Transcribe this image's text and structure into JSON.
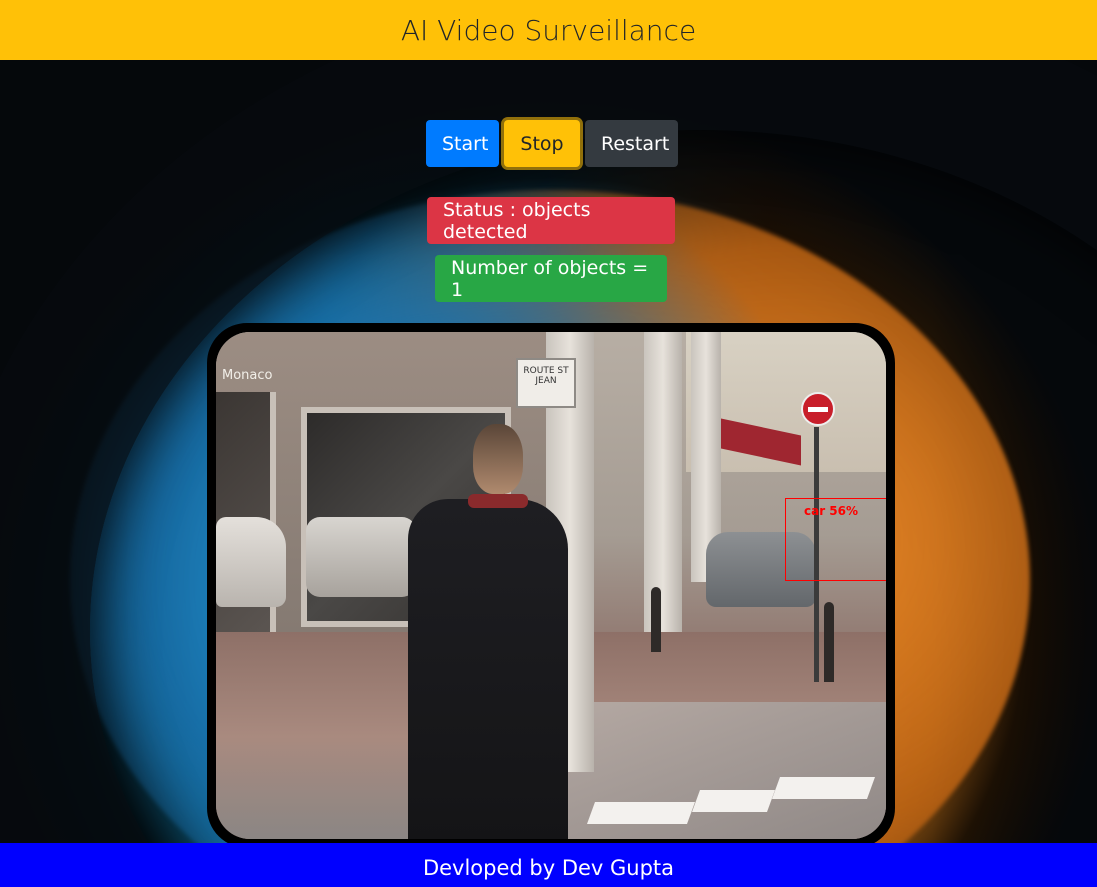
{
  "header": {
    "title": "AI Video Surveillance"
  },
  "controls": {
    "start_label": "Start",
    "stop_label": "Stop",
    "restart_label": "Restart"
  },
  "status": {
    "text": "Status : objects detected"
  },
  "counter": {
    "text": "Number of objects = 1"
  },
  "video": {
    "detection_label": "car 56%",
    "shop_name": "Monaco",
    "street_sign": "ROUTE ST JEAN"
  },
  "footer": {
    "text": "Devloped by Dev Gupta"
  },
  "colors": {
    "header_bg": "#ffc107",
    "start_bg": "#007bff",
    "stop_bg": "#ffc107",
    "restart_bg": "#343a40",
    "status_bg": "#dc3545",
    "count_bg": "#28a745",
    "footer_bg": "#0000ff",
    "detection_box": "#ff0000"
  }
}
